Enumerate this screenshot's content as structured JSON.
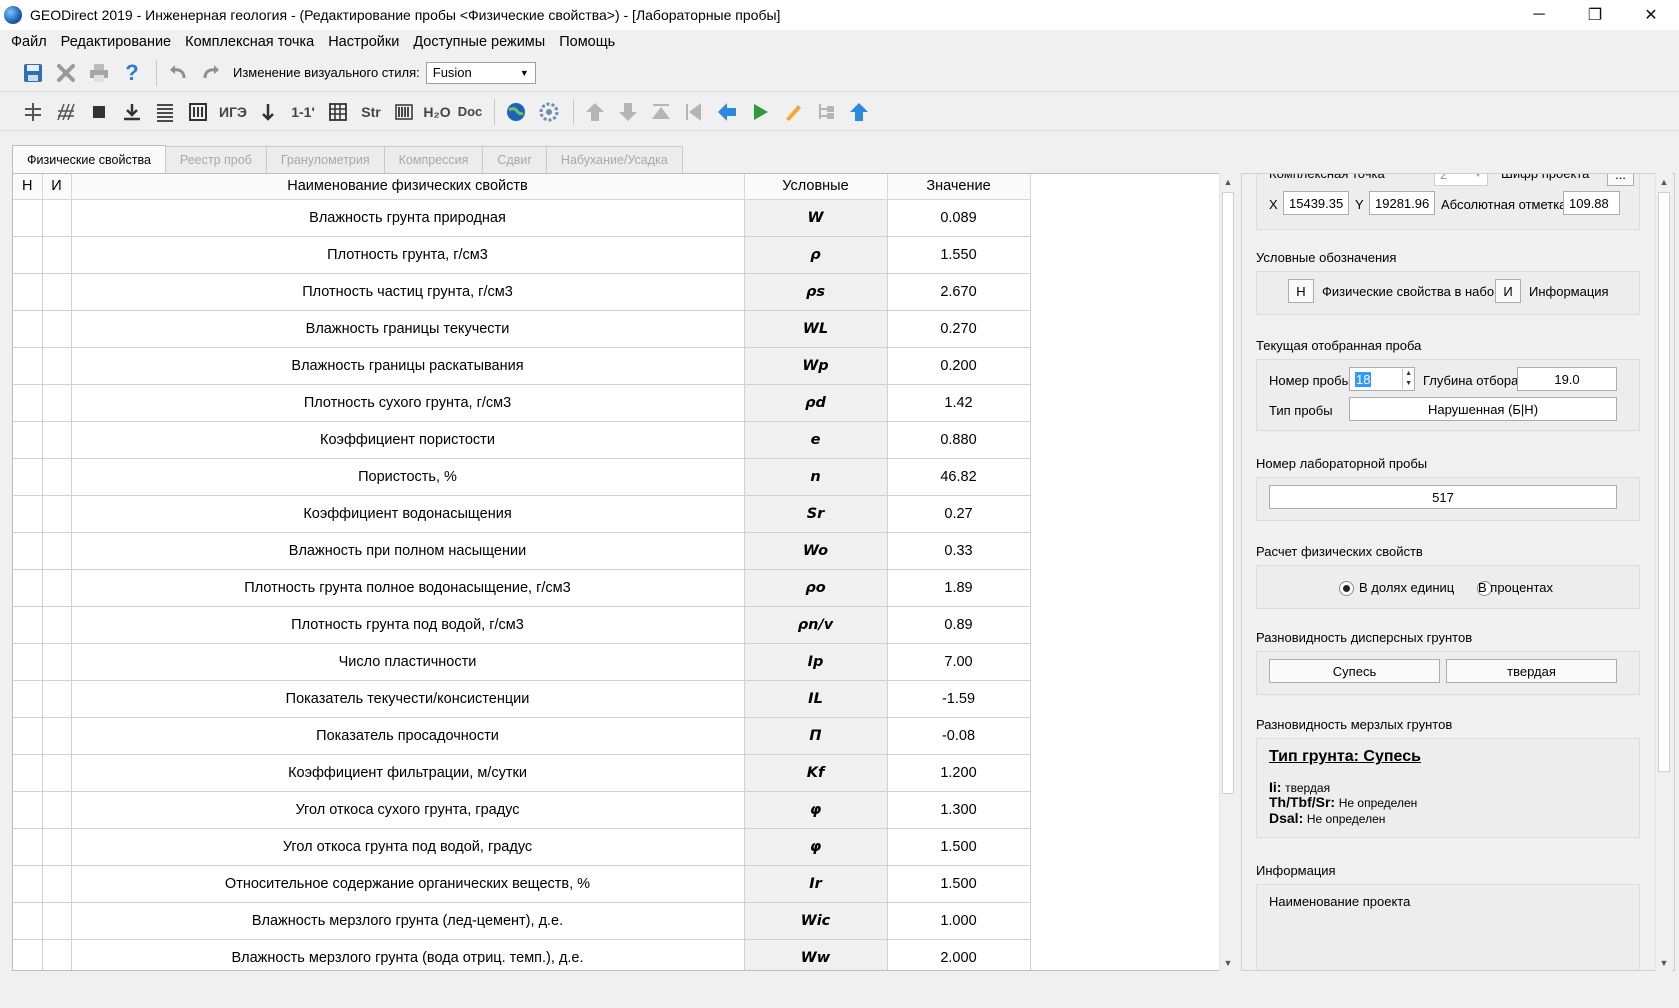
{
  "window": {
    "title": "GEODirect 2019 - Инженерная геология - (Редактирование пробы <Физические свойства>) - [Лабораторные пробы]",
    "controls": [
      "─",
      "❐",
      "✕"
    ]
  },
  "menu": [
    "Файл",
    "Редактирование",
    "Комплексная точка",
    "Настройки",
    "Доступные режимы",
    "Помощь"
  ],
  "toolbar": {
    "style_label": "Изменение визуального стиля:",
    "style_value": "Fusion",
    "text_buttons": [
      "ИГЭ",
      "1-1'",
      "Str",
      "H₂O",
      "Doc"
    ]
  },
  "tabs": [
    "Физические свойства",
    "Реестр проб",
    "Гранулометрия",
    "Компрессия",
    "Сдвиг",
    "Набухание/Усадка"
  ],
  "table": {
    "headers": [
      "Н",
      "И",
      "Наименование физических свойств",
      "Условные",
      "Значение"
    ],
    "rows": [
      {
        "name": "Влажность грунта природная",
        "symbol": "W",
        "value": "0.089"
      },
      {
        "name": "Плотность грунта, г/см3",
        "symbol": "ρ",
        "value": "1.550"
      },
      {
        "name": "Плотность частиц грунта, г/см3",
        "symbol": "ρs",
        "value": "2.670"
      },
      {
        "name": "Влажность границы текучести",
        "symbol": "WL",
        "value": "0.270"
      },
      {
        "name": "Влажность границы раскатывания",
        "symbol": "Wp",
        "value": "0.200"
      },
      {
        "name": "Плотность сухого грунта, г/см3",
        "symbol": "ρd",
        "value": "1.42"
      },
      {
        "name": "Коэффициент пористости",
        "symbol": "e",
        "value": "0.880"
      },
      {
        "name": "Пористость, %",
        "symbol": "n",
        "value": "46.82"
      },
      {
        "name": "Коэффициент водонасыщения",
        "symbol": "Sr",
        "value": "0.27"
      },
      {
        "name": "Влажность при полном насыщении",
        "symbol": "Wo",
        "value": "0.33"
      },
      {
        "name": "Плотность грунта полное водонасыщение, г/см3",
        "symbol": "ρo",
        "value": "1.89"
      },
      {
        "name": "Плотность грунта под водой, г/см3",
        "symbol": "ρn/v",
        "value": "0.89"
      },
      {
        "name": "Число пластичности",
        "symbol": "Ip",
        "value": "7.00"
      },
      {
        "name": "Показатель текучести/консистенции",
        "symbol": "IL",
        "value": "-1.59"
      },
      {
        "name": "Показатель просадочности",
        "symbol": "П",
        "value": "-0.08"
      },
      {
        "name": "Коэффициент фильтрации, м/сутки",
        "symbol": "Kf",
        "value": "1.200"
      },
      {
        "name": "Угол откоса сухого грунта, градус",
        "symbol": "φ",
        "value": "1.300"
      },
      {
        "name": "Угол откоса грунта под водой, градус",
        "symbol": "φ",
        "value": "1.500"
      },
      {
        "name": "Относительное содержание органических веществ, %",
        "symbol": "Ir",
        "value": "1.500"
      },
      {
        "name": "Влажность мерзлого грунта (лед-цемент), д.е.",
        "symbol": "Wic",
        "value": "1.000"
      },
      {
        "name": "Влажность мерзлого грунта (вода отриц. темп.), д.е.",
        "symbol": "Ww",
        "value": "2.000"
      }
    ]
  },
  "right": {
    "complex_point_label": "Комплексная точка",
    "complex_point_value": "2",
    "project_code_label": "Шифр проекта",
    "project_code_btn": "...",
    "x_label": "X",
    "x_value": "15439.35",
    "y_label": "Y",
    "y_value": "19281.96",
    "abs_label": "Абсолютная отметка",
    "abs_value": "109.88",
    "legend_title": "Условные обозначения",
    "legend_n": "Н",
    "legend_n_text": "Физические свойства в набор",
    "legend_i": "И",
    "legend_i_text": "Информация",
    "sample_title": "Текущая отобранная проба",
    "sample_no_label": "Номер пробы",
    "sample_no_value": "18",
    "depth_label": "Глубина отбора",
    "depth_value": "19.0",
    "type_label": "Тип пробы",
    "type_value": "Нарушенная (Б|Н)",
    "lab_title": "Номер лабораторной пробы",
    "lab_value": "517",
    "calc_title": "Расчет физических свойств",
    "calc_opt1": "В долях единиц",
    "calc_opt2": "В процентах",
    "disp_title": "Разновидность дисперсных грунтов",
    "disp_btn1": "Супесь",
    "disp_btn2": "твердая",
    "frozen_title": "Разновидность мерзлых грунтов",
    "frozen_heading": "Тип грунта: Супесь",
    "frozen_li_label": "Ii:",
    "frozen_li_value": "твердая",
    "frozen_th_label": "Th/Tbf/Sr:",
    "frozen_th_value": "Не определен",
    "frozen_dsal_label": "Dsal:",
    "frozen_dsal_value": "Не определен",
    "info_title": "Информация",
    "info_sub": "Наименование проекта"
  }
}
